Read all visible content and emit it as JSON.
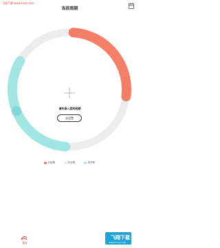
{
  "watermark": "飞翔下载 www.fxxz.com",
  "header": {
    "title": "当前周期"
  },
  "ring": {
    "hint": "请先录入您的经期",
    "settings_label": "去设置"
  },
  "legend": [
    {
      "label": "月经期",
      "color": "#f47e66"
    },
    {
      "label": "安全期",
      "color": "#ebebeb"
    },
    {
      "label": "易孕期",
      "color": "#a2e6e4"
    }
  ],
  "bottom_nav": {
    "home_label": "首页"
  },
  "logo": {
    "text": "飞翔下载",
    "sub": "WWW.FXXZ.COM"
  },
  "colors": {
    "menstrual": "#f47e66",
    "safe": "#ebebeb",
    "fertile": "#a2e6e4",
    "fertile_marker": "#82d8d6",
    "accent": "#e44444"
  }
}
